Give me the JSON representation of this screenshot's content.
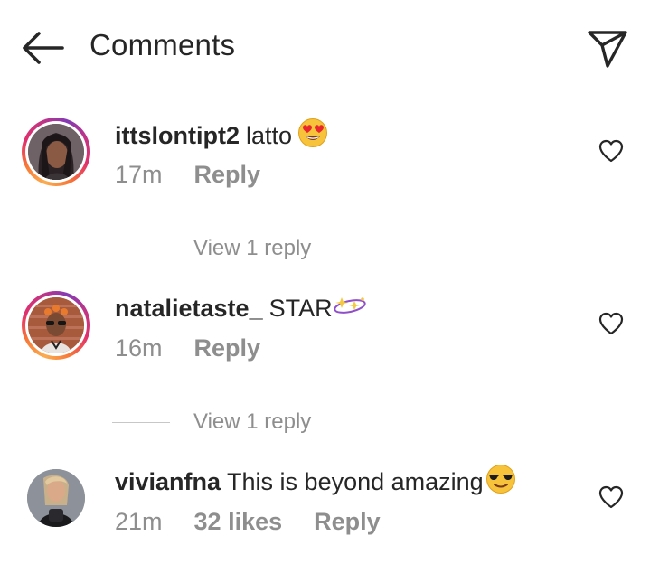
{
  "header": {
    "title": "Comments",
    "back_icon": "arrow-left-icon",
    "send_icon": "paper-plane-icon"
  },
  "comments": [
    {
      "username": "ittslontipt2",
      "text": "latto",
      "emoji": "heart-eyes-emoji",
      "time": "17m",
      "likes": "",
      "reply_label": "Reply",
      "has_story_ring": true,
      "view_replies": "View 1 reply"
    },
    {
      "username": "natalietaste_",
      "text": "STAR",
      "emoji": "sparkle-emoji",
      "time": "16m",
      "likes": "",
      "reply_label": "Reply",
      "has_story_ring": true,
      "view_replies": "View 1 reply"
    },
    {
      "username": "vivianfna",
      "text": "This is beyond amazing",
      "emoji": "sunglasses-emoji",
      "time": "21m",
      "likes": "32 likes",
      "reply_label": "Reply",
      "has_story_ring": false,
      "view_replies": ""
    }
  ],
  "colors": {
    "text_primary": "#262626",
    "text_secondary": "#8e8e8e",
    "divider": "#c7c7c7",
    "background": "#ffffff"
  }
}
